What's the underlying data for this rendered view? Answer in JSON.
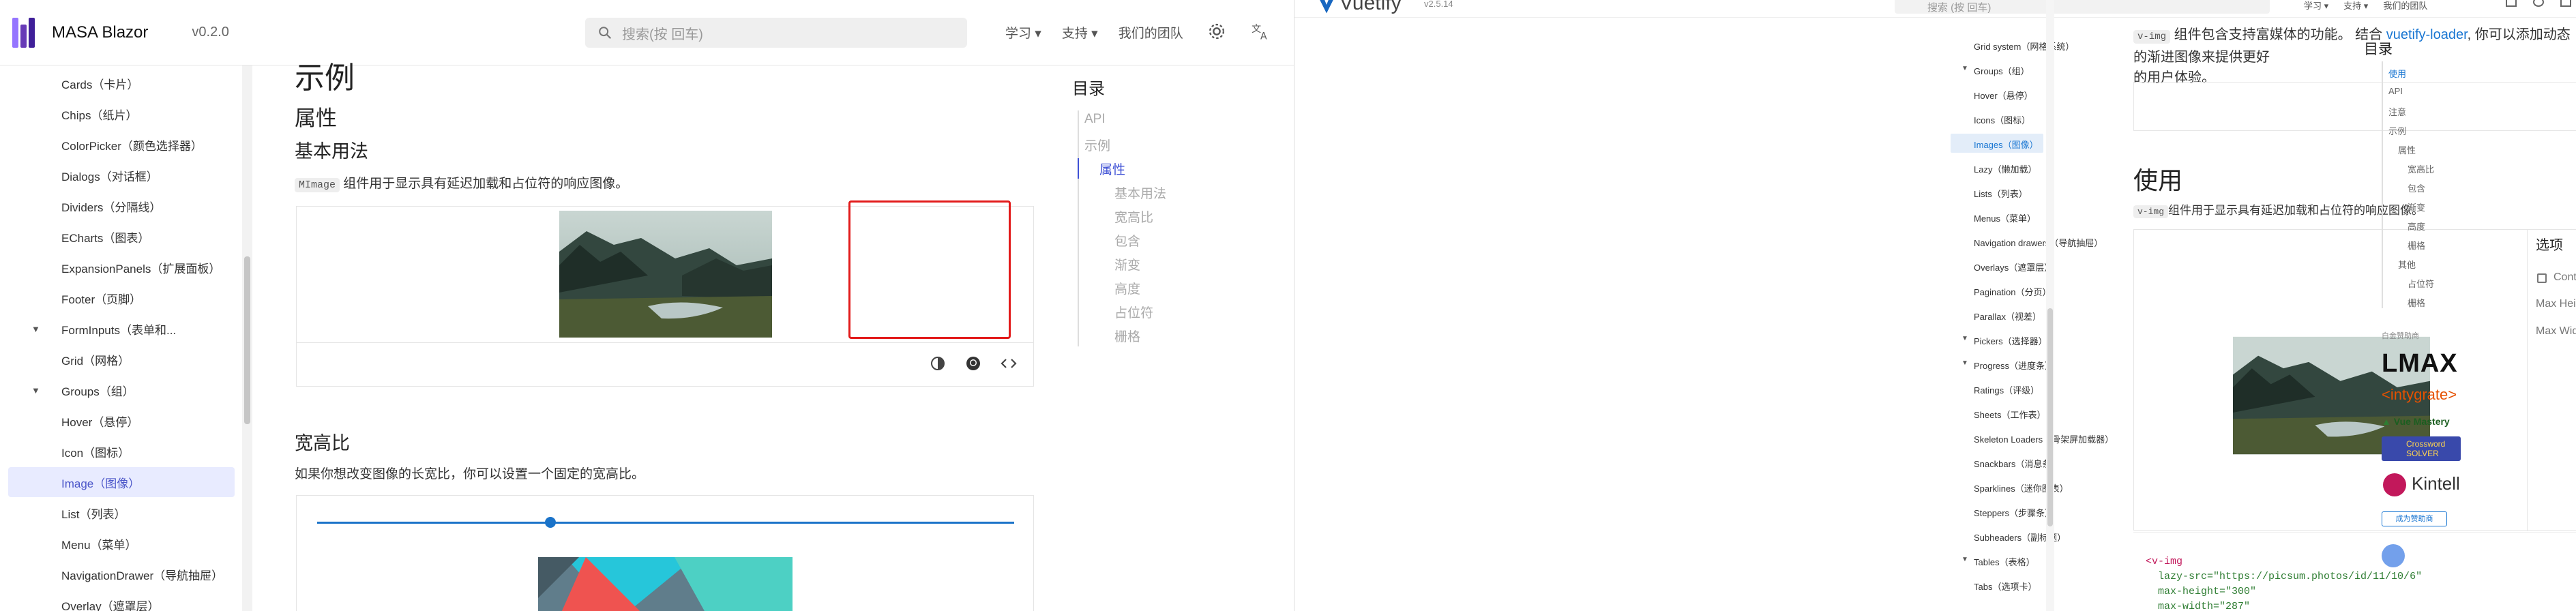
{
  "left": {
    "brand": "MASA Blazor",
    "version": "v0.2.0",
    "search_placeholder": "搜索(按 回车)",
    "nav": [
      "学习",
      "支持",
      "我们的团队"
    ],
    "sidebar": [
      {
        "label": "Cards（卡片）"
      },
      {
        "label": "Chips（纸片）"
      },
      {
        "label": "ColorPicker（颜色选择器）"
      },
      {
        "label": "Dialogs（对话框）"
      },
      {
        "label": "Dividers（分隔线）"
      },
      {
        "label": "ECharts（图表）"
      },
      {
        "label": "ExpansionPanels（扩展面板）"
      },
      {
        "label": "Footer（页脚）"
      },
      {
        "label": "FormInputs（表单和...",
        "caret": true
      },
      {
        "label": "Grid（网格）"
      },
      {
        "label": "Groups（组）",
        "caret": true
      },
      {
        "label": "Hover（悬停）"
      },
      {
        "label": "Icon（图标）"
      },
      {
        "label": "Image（图像）",
        "active": true
      },
      {
        "label": "List（列表）"
      },
      {
        "label": "Menu（菜单）"
      },
      {
        "label": "NavigationDrawer（导航抽屉）"
      },
      {
        "label": "Overlay（遮罩层）"
      }
    ],
    "main": {
      "h_examples": "示例",
      "h_props": "属性",
      "h_basic": "基本用法",
      "basic_code": "MImage",
      "basic_desc": "组件用于显示具有延迟加载和占位符的响应图像。",
      "h_ratio": "宽高比",
      "ratio_desc": "如果你想改变图像的长宽比，你可以设置一个固定的宽高比。"
    },
    "toc": {
      "title": "目录",
      "items": [
        {
          "label": "API",
          "level": 0
        },
        {
          "label": "示例",
          "level": 0
        },
        {
          "label": "属性",
          "level": 1,
          "active": true
        },
        {
          "label": "基本用法",
          "level": 2
        },
        {
          "label": "宽高比",
          "level": 2
        },
        {
          "label": "包含",
          "level": 2
        },
        {
          "label": "渐变",
          "level": 2
        },
        {
          "label": "高度",
          "level": 2
        },
        {
          "label": "占位符",
          "level": 2
        },
        {
          "label": "栅格",
          "level": 2
        }
      ]
    },
    "accent": "#4b56c9",
    "highlight": "#e21a1a"
  },
  "right": {
    "brand": "Vuetify",
    "version": "v2.5.14",
    "search_placeholder": "搜索 (按 回车)",
    "nav": [
      "学习",
      "支持",
      "我们的团队"
    ],
    "sidebar": [
      {
        "label": "Grid system（网格系统）"
      },
      {
        "label": "Groups（组）",
        "caret": true
      },
      {
        "label": "Hover（悬停）"
      },
      {
        "label": "Icons（图标）"
      },
      {
        "label": "Images（图像）",
        "active": true
      },
      {
        "label": "Lazy（懒加载）"
      },
      {
        "label": "Lists（列表）"
      },
      {
        "label": "Menus（菜单）"
      },
      {
        "label": "Navigation drawers（导航抽屉）"
      },
      {
        "label": "Overlays（遮罩层）"
      },
      {
        "label": "Pagination（分页）"
      },
      {
        "label": "Parallax（视差）"
      },
      {
        "label": "Pickers（选择器）",
        "caret": true
      },
      {
        "label": "Progress（进度条）",
        "caret": true
      },
      {
        "label": "Ratings（评级）"
      },
      {
        "label": "Sheets（工作表）"
      },
      {
        "label": "Skeleton Loaders（骨架屏加载器）"
      },
      {
        "label": "Snackbars（消息条）"
      },
      {
        "label": "Sparklines（迷你图表）"
      },
      {
        "label": "Steppers（步骤条）"
      },
      {
        "label": "Subheaders（副标题）"
      },
      {
        "label": "Tables（表格）",
        "caret": true
      },
      {
        "label": "Tabs（选项卡）"
      }
    ],
    "main": {
      "intro_code": "v-img",
      "intro_desc": "组件包含支持富媒体的功能。 结合",
      "intro_link": "vuetify-loader",
      "intro_desc2": ", 你可以添加动态的渐进图像来提供更好",
      "intro_desc3": "的用户体验。",
      "h_usage": "使用",
      "usage_code": "v-img",
      "usage_desc": "组件用于显示具有延迟加载和占位符的响应图像。",
      "options_title": "选项",
      "opt_contain": "Contain",
      "opt_max_height": "Max Height",
      "opt_max_width": "Max Width",
      "code_lines": [
        "<v-img",
        "  lazy-src=\"https://picsum.photos/id/11/10/6\"",
        "  max-height=\"300\"",
        "  max-width=\"287\""
      ]
    },
    "toc": {
      "title": "目录",
      "items": [
        {
          "label": "使用",
          "level": 0,
          "active": true
        },
        {
          "label": "API",
          "level": 0
        },
        {
          "label": "注意",
          "level": 0
        },
        {
          "label": "示例",
          "level": 0
        },
        {
          "label": "属性",
          "level": 1
        },
        {
          "label": "宽高比",
          "level": 2
        },
        {
          "label": "包含",
          "level": 2
        },
        {
          "label": "渐变",
          "level": 2
        },
        {
          "label": "高度",
          "level": 2
        },
        {
          "label": "栅格",
          "level": 2
        },
        {
          "label": "其他",
          "level": 1
        },
        {
          "label": "占位符",
          "level": 2
        },
        {
          "label": "栅格",
          "level": 2
        }
      ]
    },
    "sponsors": {
      "label": "白金赞助商",
      "lmax": "LMAX",
      "intygrate": "<intygrate>",
      "vuemastery": "Vue Mastery",
      "crossword": "Crossword SOLVER",
      "kintell": "Kintell",
      "become": "成为赞助商"
    },
    "accent": "#1976d2",
    "highlight": "#e21a1a"
  }
}
